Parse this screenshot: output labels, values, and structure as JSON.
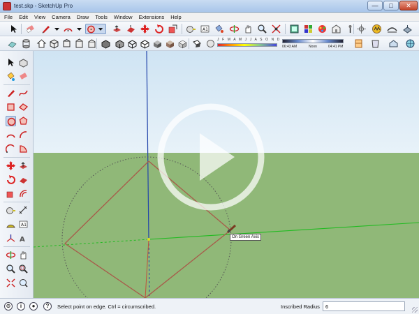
{
  "window": {
    "title": "test.skp - SketchUp Pro",
    "controls": {
      "minimize": "—",
      "maximize": "□",
      "close": "✕"
    }
  },
  "menu": [
    "File",
    "Edit",
    "View",
    "Camera",
    "Draw",
    "Tools",
    "Window",
    "Extensions",
    "Help"
  ],
  "toolbar_top": [
    "select-arrow-icon",
    "eraser-icon",
    "pencil-icon",
    "arc-icon",
    "circle-icon",
    "push-pull-icon",
    "follow-me-icon",
    "move-icon",
    "rotate-icon",
    "scale-icon",
    "text-icon",
    "paint-bucket-icon",
    "orbit-icon",
    "pan-icon",
    "zoom-icon",
    "zoom-extents-icon",
    "scenes-icon",
    "materials-icon",
    "components-icon",
    "warehouse-icon",
    "axes-icon",
    "extension-icon"
  ],
  "toolbar_views": [
    "iso-view-icon",
    "top-view-icon",
    "front-view-icon",
    "right-view-icon",
    "back-view-icon",
    "left-view-icon",
    "xray-icon",
    "wireframe-icon",
    "hidden-line-icon",
    "shaded-icon",
    "textured-icon",
    "monochrome-icon",
    "shadows-icon",
    "fog-icon"
  ],
  "shadow_settings": {
    "months": "J F M A M J J A S O N D",
    "time_start": "06:43 AM",
    "time_mid": "Noon",
    "time_end": "04:41 PM"
  },
  "viewport": {
    "tooltip": "On Green Axis",
    "colors": {
      "sky": "#cfe4f3",
      "ground": "#90b878",
      "red_axis": "#c0503c",
      "green_axis": "#22bb22",
      "blue_axis": "#2244aa"
    }
  },
  "status": {
    "hint": "Select point on edge. Ctrl = circumscribed.",
    "vcb_label": "Inscribed Radius",
    "vcb_value": "6"
  }
}
